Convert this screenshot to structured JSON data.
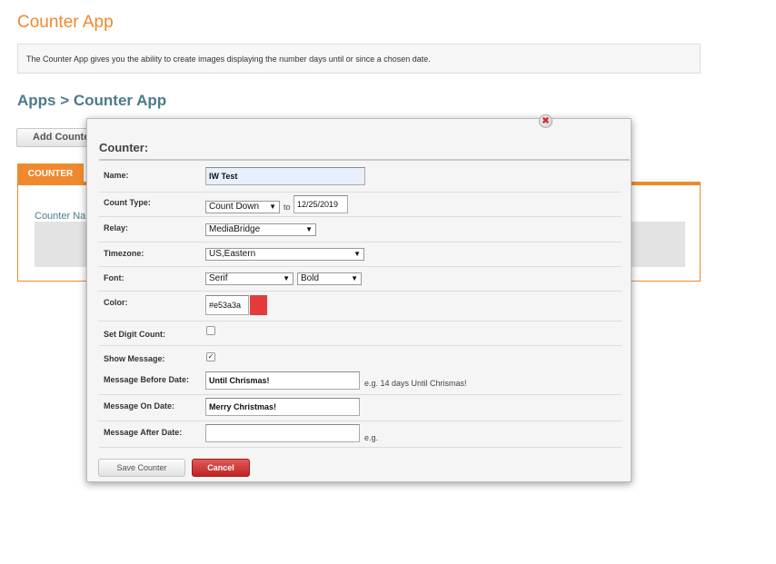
{
  "app_title": "Counter App",
  "description": "The Counter App gives you the ability to create images displaying the number days until or since a chosen date.",
  "breadcrumb": "Apps > Counter App",
  "add_button_label": "Add Counter",
  "tab_label": "COUNTER",
  "column_header": "Counter Name",
  "modal": {
    "heading": "Counter:",
    "name": {
      "label": "Name:",
      "value": "IW Test"
    },
    "count_type": {
      "label": "Count Type:",
      "value": "Count Down",
      "to_text": "to",
      "date": "12/25/2019"
    },
    "relay": {
      "label": "Relay:",
      "value": "MediaBridge"
    },
    "timezone": {
      "label": "Timezone:",
      "value": "US,Eastern"
    },
    "font": {
      "label": "Font:",
      "family": "Serif",
      "weight": "Bold"
    },
    "color": {
      "label": "Color:",
      "value": "#e53a3a",
      "swatch": "#e53a3a"
    },
    "digit_count": {
      "label": "Set Digit Count:",
      "checked": false
    },
    "show_message": {
      "label": "Show Message:",
      "checked": true
    },
    "msg_before": {
      "label": "Message Before Date:",
      "value": "Until Chrismas!",
      "hint": "e.g. 14 days Until Chrismas!"
    },
    "msg_on": {
      "label": "Message On Date:",
      "value": "Merry Christmas!"
    },
    "msg_after": {
      "label": "Message After Date:",
      "value": "",
      "hint": "e.g."
    },
    "save_label": "Save Counter",
    "cancel_label": "Cancel",
    "close_symbol": "✖"
  },
  "colors": {
    "accent": "#f0892e",
    "teal": "#4a7b8c",
    "cancel": "#c62828"
  },
  "icons": {
    "close": "close-icon",
    "dropdown": "chevron-down-icon"
  }
}
